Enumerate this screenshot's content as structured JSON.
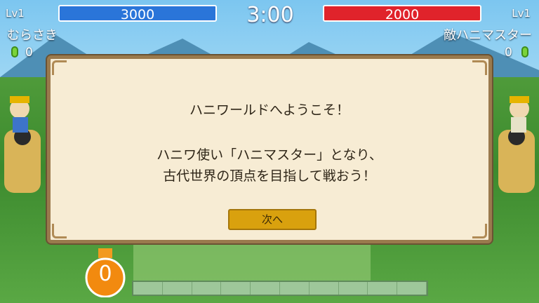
{
  "timer": "3:00",
  "player": {
    "level": "Lv1",
    "name": "むらさき",
    "hp": "3000",
    "gems": "0"
  },
  "enemy": {
    "level": "Lv1",
    "name": "敵ハニマスター",
    "hp": "2000",
    "gems": "0"
  },
  "dialog": {
    "line1": "ハニワールドへようこそ！",
    "line2": "ハニワ使い「ハニマスター」となり、",
    "line3": "古代世界の頂点を目指して戦おう！",
    "next_label": "次へ"
  },
  "money": "0",
  "colors": {
    "player_bar": "#2a75d9",
    "enemy_bar": "#e0232b",
    "button": "#d9a10e",
    "dialog_bg": "#f7ecd4"
  }
}
